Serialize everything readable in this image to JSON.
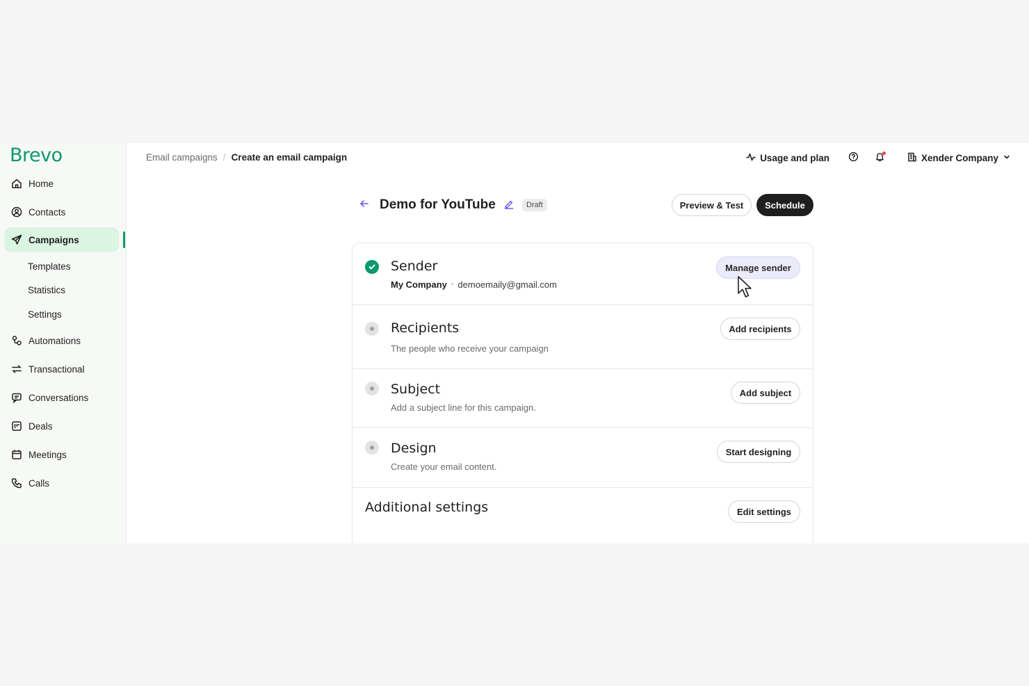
{
  "brand": {
    "logo": "Brevo",
    "accent": "#0b996e"
  },
  "sidebar": {
    "items": [
      {
        "label": "Home",
        "icon": "home-icon"
      },
      {
        "label": "Contacts",
        "icon": "contacts-icon"
      },
      {
        "label": "Campaigns",
        "icon": "send-icon",
        "active": true
      },
      {
        "label": "Automations",
        "icon": "automation-icon"
      },
      {
        "label": "Transactional",
        "icon": "transactional-icon"
      },
      {
        "label": "Conversations",
        "icon": "chat-icon"
      },
      {
        "label": "Deals",
        "icon": "deals-icon"
      },
      {
        "label": "Meetings",
        "icon": "calendar-icon"
      },
      {
        "label": "Calls",
        "icon": "phone-icon"
      }
    ],
    "sub_items": [
      "Templates",
      "Statistics",
      "Settings"
    ]
  },
  "breadcrumb": {
    "parent": "Email campaigns",
    "separator": "/",
    "current": "Create an email campaign"
  },
  "topbar": {
    "usage": "Usage and plan",
    "account": "Xender Company"
  },
  "campaign": {
    "title": "Demo for YouTube",
    "status": "Draft",
    "preview_label": "Preview & Test",
    "schedule_label": "Schedule"
  },
  "sections": {
    "sender": {
      "title": "Sender",
      "name": "My Company",
      "email": "demoemaily@gmail.com",
      "button": "Manage sender",
      "complete": true
    },
    "recipients": {
      "title": "Recipients",
      "desc": "The people who receive your campaign",
      "button": "Add recipients"
    },
    "subject": {
      "title": "Subject",
      "desc": "Add a subject line for this campaign.",
      "button": "Add subject"
    },
    "design": {
      "title": "Design",
      "desc": "Create your email content.",
      "button": "Start designing"
    },
    "additional": {
      "title": "Additional settings",
      "button": "Edit settings"
    }
  }
}
